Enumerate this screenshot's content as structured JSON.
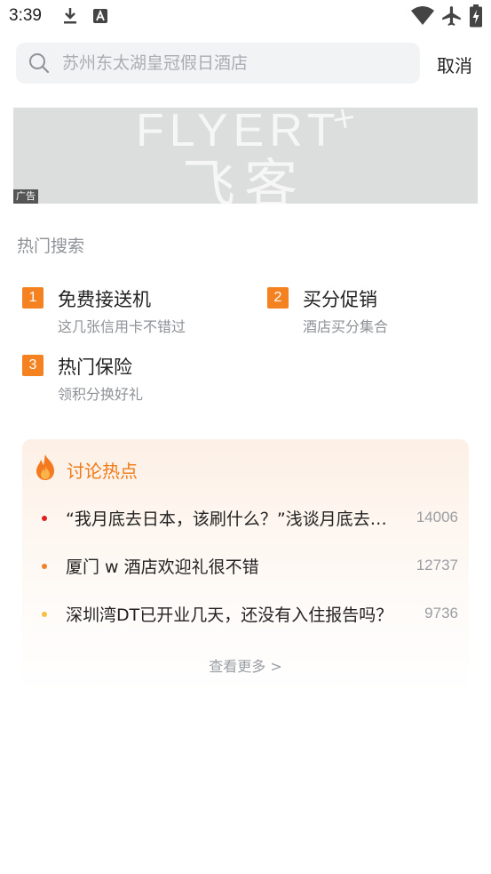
{
  "status_bar": {
    "time": "3:39"
  },
  "search": {
    "placeholder": "苏州东太湖皇冠假日酒店",
    "cancel_label": "取消"
  },
  "ad": {
    "logo_en": "FLYERT",
    "logo_plus": "+",
    "logo_cn": "飞客",
    "badge": "广告"
  },
  "hot_search": {
    "title": "热门搜索",
    "items": [
      {
        "rank": "1",
        "title": "免费接送机",
        "subtitle": "这几张信用卡不错过"
      },
      {
        "rank": "2",
        "title": "买分促销",
        "subtitle": "酒店买分集合"
      },
      {
        "rank": "3",
        "title": "热门保险",
        "subtitle": "领积分换好礼"
      }
    ],
    "rank_color": "#F58220"
  },
  "discussion": {
    "title": "讨论热点",
    "title_color": "#F07A16",
    "items": [
      {
        "text": "“我月底去日本，该刷什么？”浅谈月底去日本该刷什么卡",
        "count": "14006",
        "dot_color": "#E02020"
      },
      {
        "text": "厦门 w 酒店欢迎礼很不错",
        "count": "12737",
        "dot_color": "#F0802A"
      },
      {
        "text": "深圳湾DT已开业几天，还没有入住报告吗？",
        "count": "9736",
        "dot_color": "#F5C040"
      }
    ],
    "more_label": "查看更多 >"
  }
}
